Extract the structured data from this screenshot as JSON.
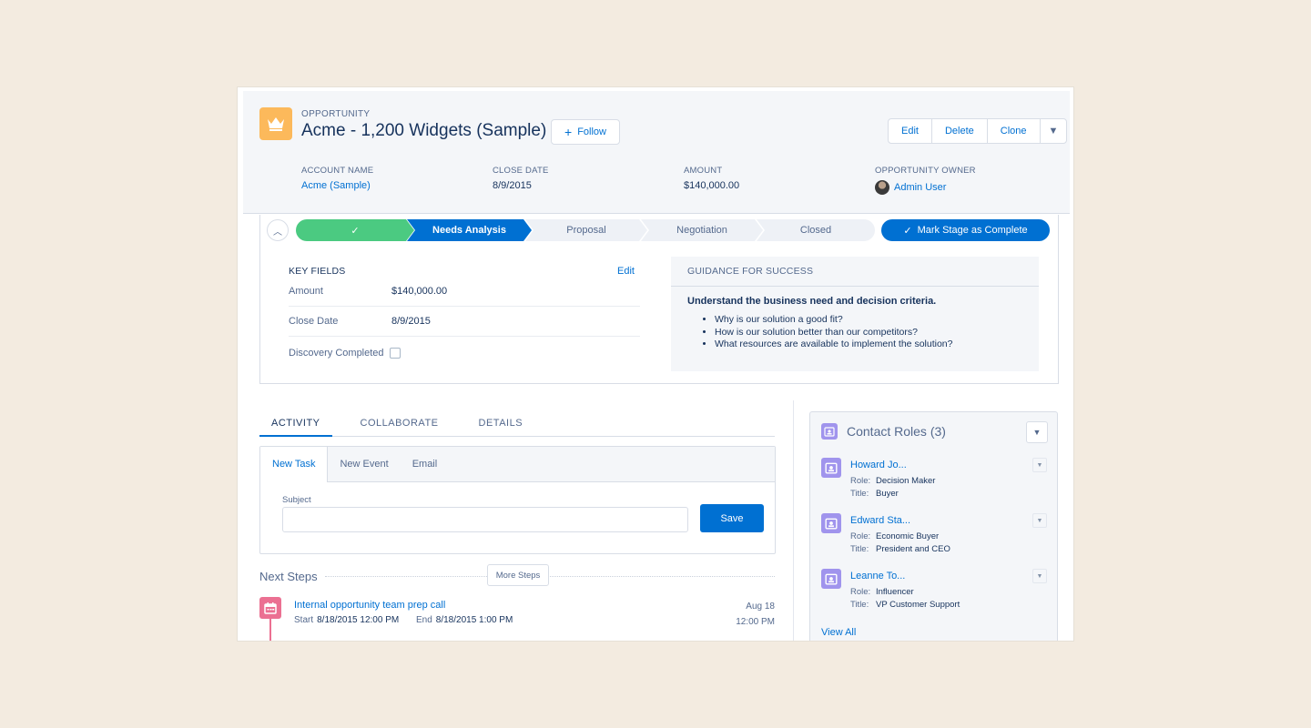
{
  "header": {
    "record_type": "OPPORTUNITY",
    "title": "Acme - 1,200 Widgets (Sample)",
    "follow_label": "Follow",
    "actions": [
      "Edit",
      "Delete",
      "Clone"
    ],
    "icon": "crown-icon",
    "fields": [
      {
        "label": "ACCOUNT NAME",
        "value": "Acme (Sample)"
      },
      {
        "label": "CLOSE DATE",
        "value": "8/9/2015"
      },
      {
        "label": "AMOUNT",
        "value": "$140,000.00"
      },
      {
        "label": "OPPORTUNITY OWNER",
        "value": "Admin User"
      }
    ]
  },
  "path": {
    "stages": [
      {
        "label": "",
        "status": "complete"
      },
      {
        "label": "Needs Analysis",
        "status": "current"
      },
      {
        "label": "Proposal",
        "status": "incomplete"
      },
      {
        "label": "Negotiation",
        "status": "incomplete"
      },
      {
        "label": "Closed",
        "status": "incomplete"
      }
    ],
    "mark_complete_label": "Mark Stage as Complete"
  },
  "key_fields": {
    "heading": "KEY FIELDS",
    "edit_label": "Edit",
    "rows": [
      {
        "label": "Amount",
        "value": "$140,000.00"
      },
      {
        "label": "Close Date",
        "value": "8/9/2015"
      },
      {
        "label": "Discovery Completed",
        "value": ""
      }
    ],
    "discovery_completed": false
  },
  "guidance": {
    "heading": "GUIDANCE FOR SUCCESS",
    "title": "Understand the business need and decision criteria.",
    "items": [
      "Why is our solution a good fit?",
      "How is our solution better than our competitors?",
      "What resources are available to implement the solution?"
    ]
  },
  "tabs": [
    "ACTIVITY",
    "COLLABORATE",
    "DETAILS"
  ],
  "publisher": {
    "tabs": [
      "New Task",
      "New Event",
      "Email"
    ],
    "subject_label": "Subject",
    "subject_value": "",
    "save_label": "Save"
  },
  "next_steps": {
    "label": "Next Steps",
    "more_label": "More Steps",
    "task": {
      "title": "Internal opportunity team prep call",
      "start_label": "Start",
      "start": "8/18/2015 12:00 PM",
      "end_label": "End",
      "end": "8/18/2015 1:00 PM",
      "date": "Aug 18",
      "time": "12:00 PM"
    }
  },
  "contact_roles": {
    "title": "Contact Roles (3)",
    "role_label": "Role:",
    "title_label": "Title:",
    "items": [
      {
        "name": "Howard Jo...",
        "role": "Decision Maker",
        "title": "Buyer"
      },
      {
        "name": "Edward Sta...",
        "role": "Economic Buyer",
        "title": "President and CEO"
      },
      {
        "name": "Leanne To...",
        "role": "Influencer",
        "title": "VP Customer Support"
      }
    ],
    "view_all": "View All"
  },
  "colors": {
    "brand": "#0070d2",
    "complete": "#4bca81",
    "opportunity_icon": "#fcb95b",
    "contact_icon": "#a094ed",
    "event_icon": "#eb7092"
  }
}
